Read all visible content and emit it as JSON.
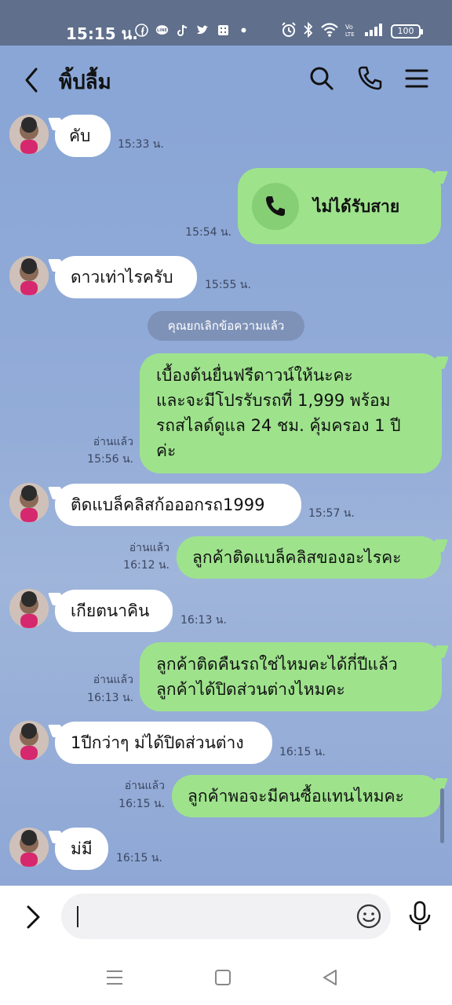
{
  "status_bar": {
    "time": "15:15 น.",
    "app_icons": [
      "facebook-icon",
      "line-icon",
      "tiktok-icon",
      "twitter-icon",
      "calendar-icon",
      "dot-icon"
    ],
    "system_icons": [
      "alarm-icon",
      "bluetooth-icon",
      "wifi-icon",
      "volte-icon",
      "signal-icon"
    ],
    "battery": "100"
  },
  "header": {
    "title": "พิ้ปลื้ม"
  },
  "messages": [
    {
      "dir": "in",
      "text": "คับ",
      "time": "15:33 น."
    },
    {
      "dir": "out",
      "type": "call",
      "text": "ไม่ได้รับสาย",
      "time": "15:54 น."
    },
    {
      "dir": "in",
      "text": "ดาวเท่าไรครับ",
      "time": "15:55 น."
    },
    {
      "dir": "system",
      "text": "คุณยกเลิกข้อความแล้ว"
    },
    {
      "dir": "out",
      "lines": [
        "เบื้องต้นยื่นฟรีดาวน์ให้นะคะ",
        "และจะมีโปรรับรถที่ 1,999 พร้อม",
        "รถสไลด์ดูแล 24 ชม. คุ้มครอง 1 ปี",
        "ค่ะ"
      ],
      "read": "อ่านแล้ว",
      "time": "15:56 น."
    },
    {
      "dir": "in",
      "text": "ติดแบล็คลิสก้อออกรถ1999",
      "time": "15:57 น."
    },
    {
      "dir": "out",
      "text": "ลูกค้าติดแบล็คลิสของอะไรคะ",
      "read": "อ่านแล้ว",
      "time": "16:12 น."
    },
    {
      "dir": "in",
      "text": "เกียตนาคิน",
      "time": "16:13 น."
    },
    {
      "dir": "out",
      "lines": [
        "ลูกค้าติดคืนรถใช่ไหมคะได้กี่ปีแล้ว",
        "ลูกค้าได้ปิดส่วนต่างไหมคะ"
      ],
      "read": "อ่านแล้ว",
      "time": "16:13 น."
    },
    {
      "dir": "in",
      "text": "1ปีกว่าๆ ม่ได้ปิดส่วนต่าง",
      "time": "16:15 น."
    },
    {
      "dir": "out",
      "text": "ลูกค้าพอจะมีคนซื้อแทนไหมคะ",
      "read": "อ่านแล้ว",
      "time": "16:15 น."
    },
    {
      "dir": "in",
      "text": "ม่มี",
      "time": "16:15 น."
    }
  ],
  "input": {
    "value": ""
  },
  "colors": {
    "chat_bg": "#8aa6d6",
    "outgoing_bubble": "#9ee38c",
    "incoming_bubble": "#ffffff",
    "status_bar": "#5f6f8c"
  }
}
